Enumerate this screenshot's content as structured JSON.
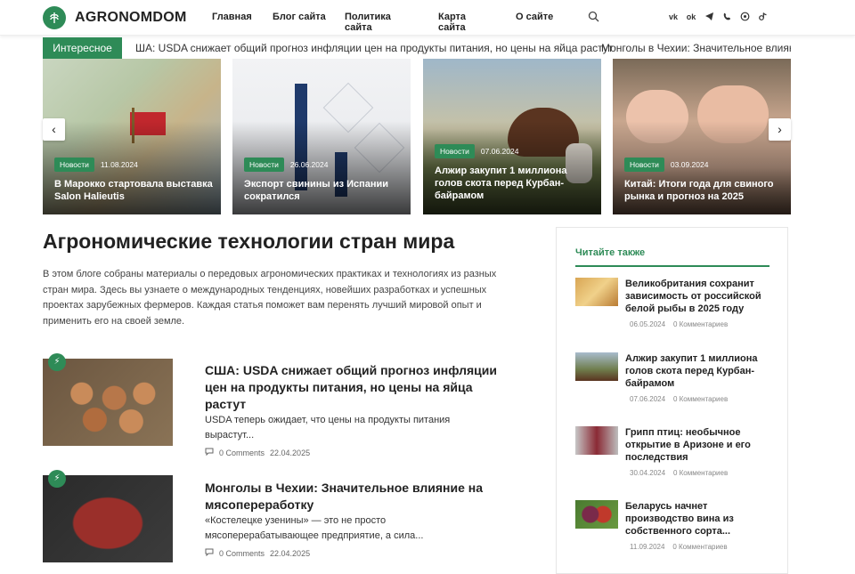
{
  "header": {
    "logo": "AGRONOMDOM",
    "nav": [
      "Главная",
      "Блог сайта",
      "Политика сайта",
      "Карта сайта",
      "О сайте"
    ],
    "social_icons": [
      "vk-icon",
      "odnoklassniki-icon",
      "telegram-icon",
      "viber-icon",
      "whatsapp-icon",
      "tiktok-icon"
    ]
  },
  "ticker": {
    "label": "Интересное",
    "text": "ША: USDA снижает общий прогноз инфляции цен на продукты питания, но цены на яйца растут",
    "text2": "Монголы в Чехии: Значительное влияние"
  },
  "slider": [
    {
      "badge": "Новости",
      "date": "11.08.2024",
      "title": "В Марокко стартовала выставка Salon Halieutis"
    },
    {
      "badge": "Новости",
      "date": "26.06.2024",
      "title": "Экспорт свинины из Испании сократился"
    },
    {
      "badge": "Новости",
      "date": "07.06.2024",
      "title": "Алжир закупит 1 миллиона голов скота перед Курбан-байрамом"
    },
    {
      "badge": "Новости",
      "date": "03.09.2024",
      "title": "Китай: Итоги года для свиного рынка и прогноз на 2025"
    }
  ],
  "main": {
    "title": "Агрономические технологии стран мира",
    "intro": "В этом блоге собраны материалы о передовых агрономических практиках и технологиях из разных стран мира. Здесь вы узнаете о международных тенденциях, новейших разработках и успешных проектах зарубежных фермеров. Каждая статья поможет вам перенять лучший мировой опыт и применить его на своей земле."
  },
  "posts": [
    {
      "title": "США: USDA снижает общий прогноз инфляции цен на продукты питания, но цены на яйца растут",
      "excerpt": "   USDA теперь ожидает, что цены на продукты питания вырастут...",
      "comments": "0 Comments",
      "date": "22.04.2025"
    },
    {
      "title": "Монголы в Чехии: Значительное влияние на мясопереработку",
      "excerpt": "«Костелецке узенины» — это не просто мясоперерабатывающее предприятие, а сила...",
      "comments": "0 Comments",
      "date": "22.04.2025"
    }
  ],
  "sidebar": {
    "heading": "Читайте также",
    "items": [
      {
        "title": "Великобритания сохранит зависимость от российской белой рыбы в 2025 году",
        "date": "06.05.2024",
        "comments": "0 Комментариев"
      },
      {
        "title": "Алжир закупит 1 миллиона голов скота перед Курбан-байрамом",
        "date": "07.06.2024",
        "comments": "0 Комментариев"
      },
      {
        "title": "Грипп птиц: необычное открытие в Аризоне и его последствия",
        "date": "30.04.2024",
        "comments": "0 Комментариев"
      },
      {
        "title": "Беларусь начнет производство вина из собственного сорта...",
        "date": "11.09.2024",
        "comments": "0 Комментариев"
      }
    ]
  },
  "colors": {
    "accent": "#2e8b57"
  }
}
